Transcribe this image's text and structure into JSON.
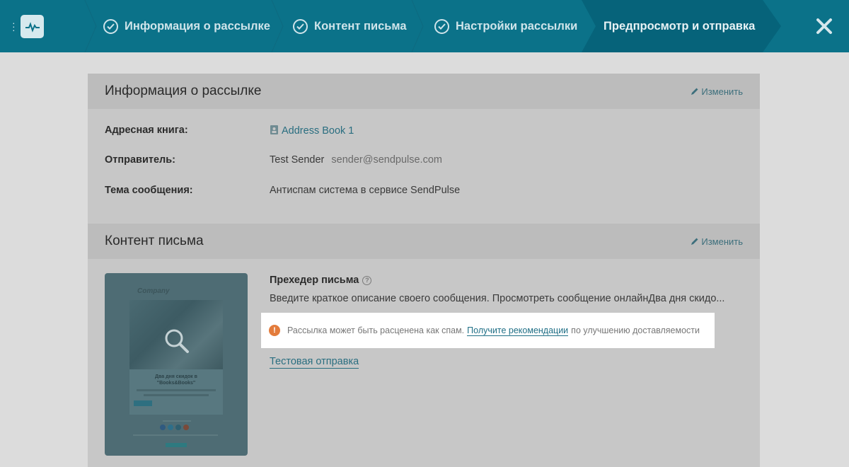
{
  "topbar": {
    "steps": [
      {
        "label": "Информация о рассылке",
        "done": true
      },
      {
        "label": "Контент письма",
        "done": true
      },
      {
        "label": "Настройки рассылки",
        "done": true
      },
      {
        "label": "Предпросмотр и отправка",
        "done": false,
        "active": true
      }
    ],
    "close_icon": "close-icon",
    "logo_icon": "pulse-icon",
    "colors": {
      "bar": "#0b7289",
      "active_step": "#06637a"
    }
  },
  "info_panel": {
    "title": "Информация о рассылке",
    "edit_label": "Изменить",
    "rows": [
      {
        "label": "Адресная книга:",
        "value": "Address Book 1"
      },
      {
        "label": "Отправитель:",
        "value": "Test Sender",
        "extra": "sender@sendpulse.com"
      },
      {
        "label": "Тема сообщения:",
        "value": "Антиспам система в сервисе SendPulse"
      }
    ]
  },
  "content_panel": {
    "title": "Контент письма",
    "edit_label": "Изменить",
    "preheader_label": "Прехедер письма",
    "preheader_text": "Введите краткое описание своего сообщения. Просмотреть сообщение онлайнДва дня скидо...",
    "preview": {
      "company": "Company",
      "headline": "Два дня скидок в \"Books&Books\""
    },
    "spam_warning": {
      "text_before": "Рассылка может быть расценена как спам.",
      "link": "Получите рекомендации",
      "text_after": "по улучшению доставляемости",
      "color": "#e37c3c"
    },
    "test_send_label": "Тестовая отправка"
  }
}
